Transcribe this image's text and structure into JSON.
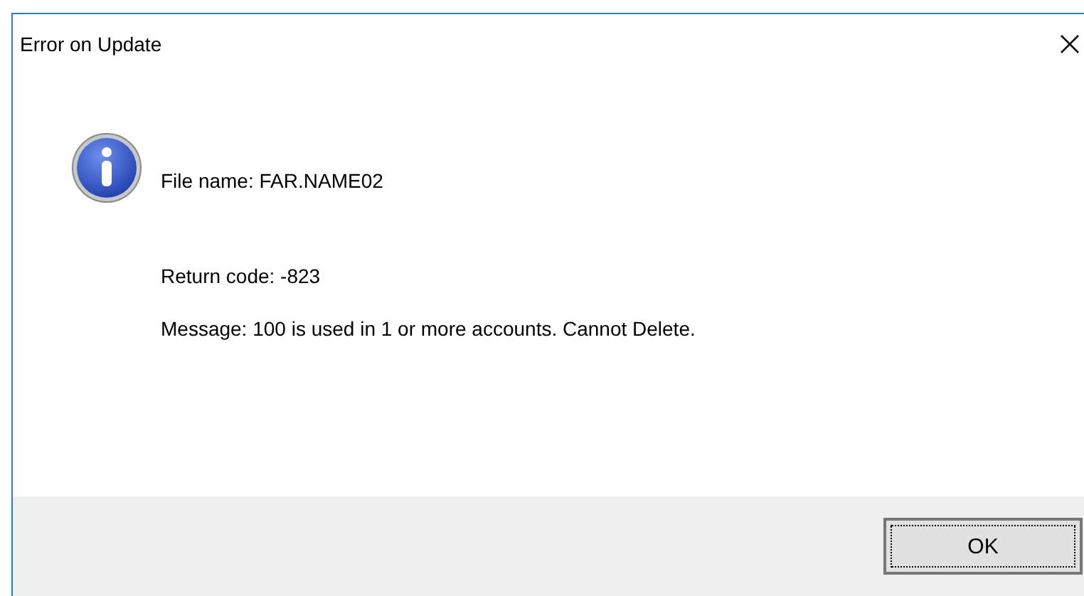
{
  "window": {
    "title": "Error on Update"
  },
  "message_lines": [
    "File name:  FAR.NAME02",
    "Return code:  -823",
    "Message:  100 is used in 1 or more accounts. Cannot Delete."
  ],
  "buttons": [
    {
      "label": "OK",
      "focused": true
    }
  ]
}
